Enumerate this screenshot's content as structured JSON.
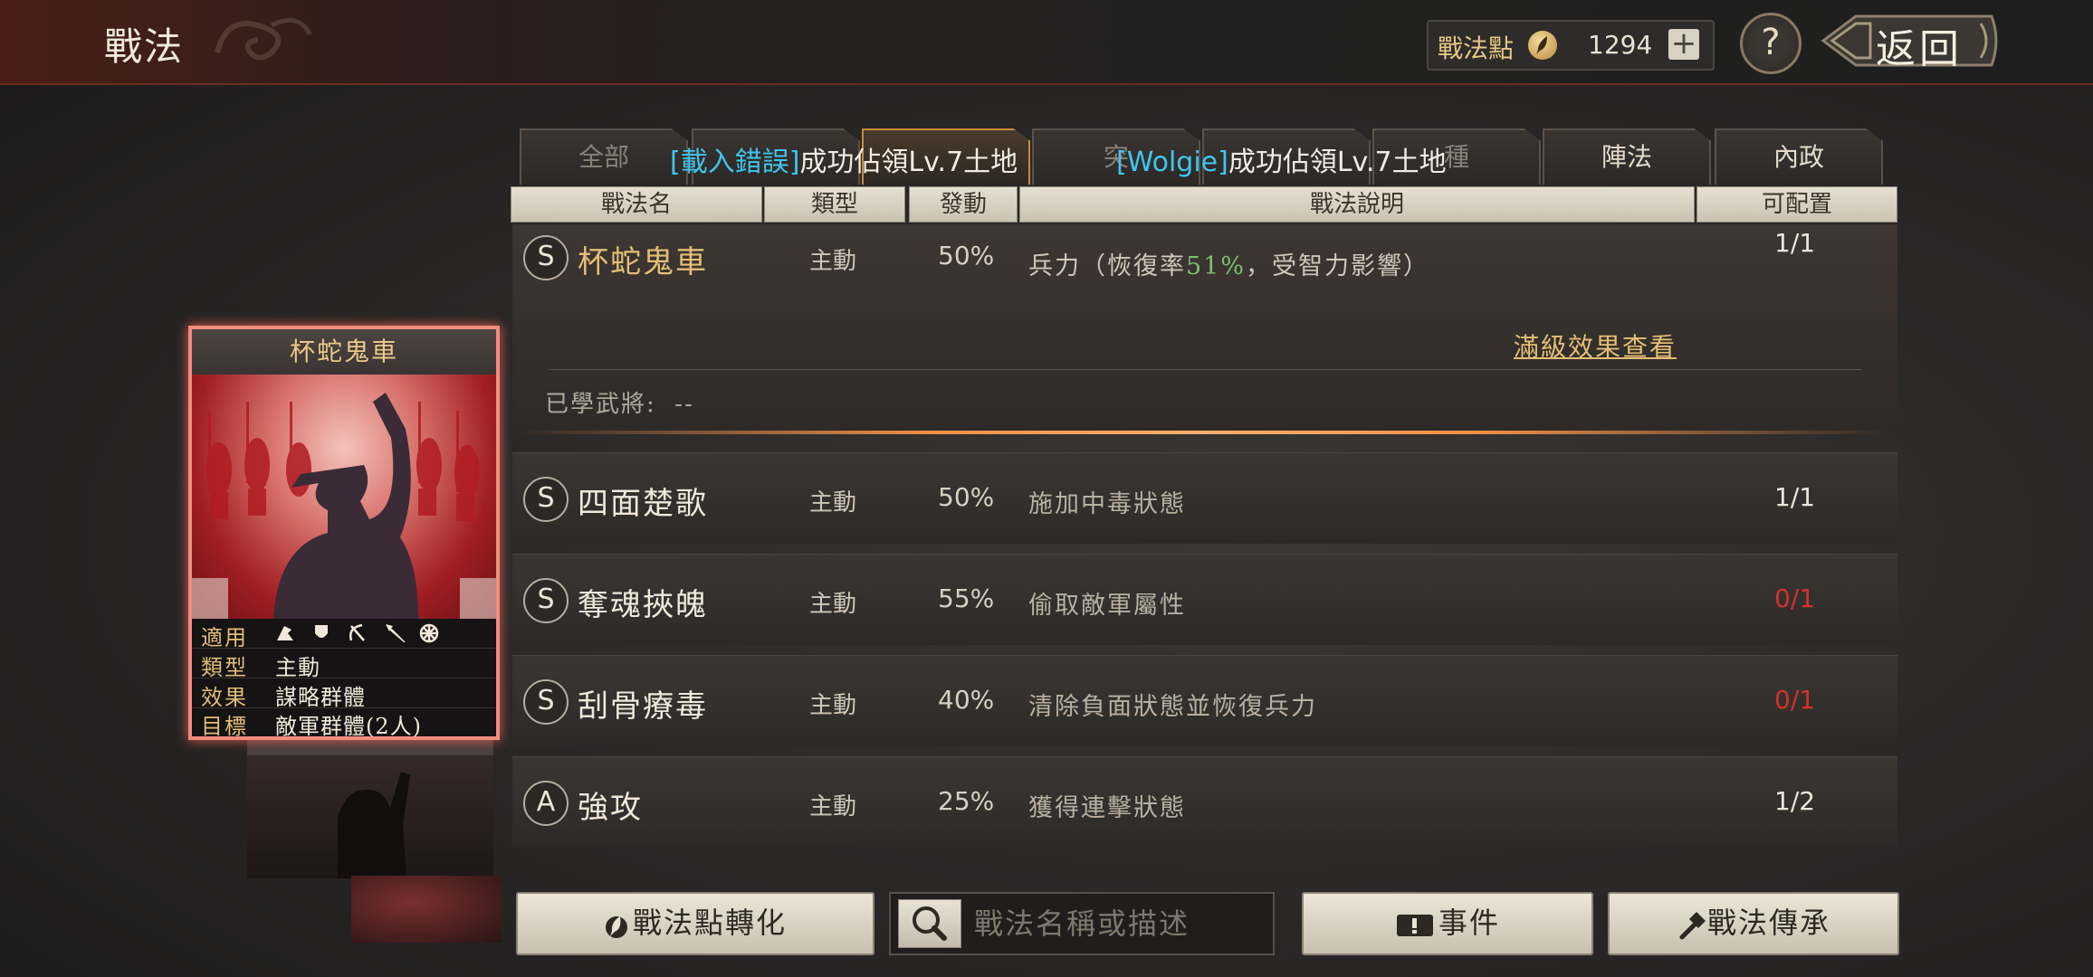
{
  "header": {
    "title": "戰法",
    "points_label": "戰法點",
    "points_value": "1294",
    "plus": "+",
    "help": "?",
    "back": "返回"
  },
  "tabs": [
    {
      "label": "全部"
    },
    {
      "label": ""
    },
    {
      "label": ""
    },
    {
      "label": "突"
    },
    {
      "label": ""
    },
    {
      "label": "種"
    },
    {
      "label": "陣法"
    },
    {
      "label": "內政"
    }
  ],
  "notices": [
    {
      "tag": "[載入錯誤]",
      "text": "成功佔領Lv.7土地"
    },
    {
      "tag": "[Wolgie]",
      "text": "成功佔領Lv.7土地"
    }
  ],
  "columns": {
    "name": "戰法名",
    "type": "類型",
    "rate": "發動",
    "desc": "戰法說明",
    "slots": "可配置"
  },
  "expanded": {
    "grade": "S",
    "name": "杯蛇鬼車",
    "type": "主動",
    "rate": "50%",
    "desc_prefix": "兵力（恢復率",
    "desc_rate": "51%",
    "desc_suffix": "，受智力影響）",
    "slots": "1/1",
    "link": "滿級效果查看",
    "learned_label": "已學武將:",
    "learned_value": "--"
  },
  "rows": [
    {
      "grade": "S",
      "name": "四面楚歌",
      "type": "主動",
      "rate": "50%",
      "desc": "施加中毒狀態",
      "slots": "1/1",
      "slots_red": false
    },
    {
      "grade": "S",
      "name": "奪魂挾魄",
      "type": "主動",
      "rate": "55%",
      "desc": "偷取敵軍屬性",
      "slots": "0/1",
      "slots_red": true
    },
    {
      "grade": "S",
      "name": "刮骨療毒",
      "type": "主動",
      "rate": "40%",
      "desc": "清除負面狀態並恢復兵力",
      "slots": "0/1",
      "slots_red": true
    },
    {
      "grade": "A",
      "name": "強攻",
      "type": "主動",
      "rate": "25%",
      "desc": "獲得連擊狀態",
      "slots": "1/2",
      "slots_red": false
    }
  ],
  "card": {
    "title": "杯蛇鬼車",
    "apply_label": "適用",
    "type_label": "類型",
    "type_value": "主動",
    "effect_label": "效果",
    "effect_value": "謀略群體",
    "target_label": "目標",
    "target_value": "敵軍群體(2人)"
  },
  "bottom": {
    "convert": "戰法點轉化",
    "search_placeholder": "戰法名稱或描述",
    "event": "事件",
    "inherit": "戰法傳承"
  },
  "colors": {
    "accent_gold": "#e3bf76",
    "notice_cyan": "#3fc6ee",
    "slot_red": "#d4312a",
    "card_border": "#f08d7d"
  }
}
